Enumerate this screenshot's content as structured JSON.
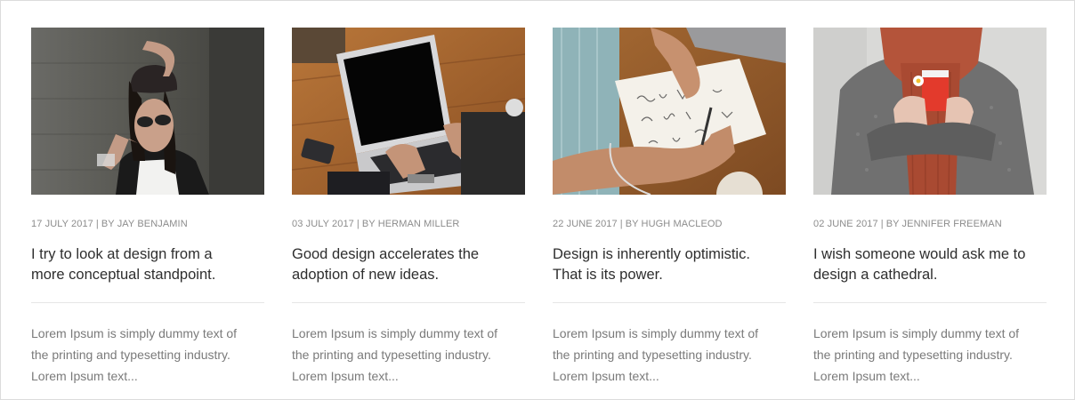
{
  "posts": [
    {
      "image": "woman-with-sunglasses-photo",
      "date": "17 JULY 2017",
      "separator": "|",
      "author": "BY JAY BENJAMIN",
      "title": "I try to look at design from a more conceptual standpoint.",
      "excerpt": "Lorem Ipsum is simply dummy text of the printing and typesetting industry. Lorem Ipsum text..."
    },
    {
      "image": "laptop-on-desk-photo",
      "date": "03 JULY 2017",
      "separator": "|",
      "author": "BY HERMAN MILLER",
      "title": "Good design accelerates the adoption of new ideas.",
      "excerpt": "Lorem Ipsum is simply dummy text of the printing and typesetting industry. Lorem Ipsum text..."
    },
    {
      "image": "sketching-in-notebook-photo",
      "date": "22 JUNE 2017",
      "separator": "|",
      "author": "BY HUGH MACLEOD",
      "title": "Design is inherently optimistic. That is its power.",
      "excerpt": "Lorem Ipsum is simply dummy text of the printing and typesetting industry. Lorem Ipsum text..."
    },
    {
      "image": "woman-holding-coffee-cup-photo",
      "date": "02 JUNE 2017",
      "separator": "|",
      "author": "BY JENNIFER FREEMAN",
      "title": "I wish someone would ask me to design a cathedral.",
      "excerpt": "Lorem Ipsum is simply dummy text of the printing and typesetting industry. Lorem Ipsum text..."
    }
  ]
}
